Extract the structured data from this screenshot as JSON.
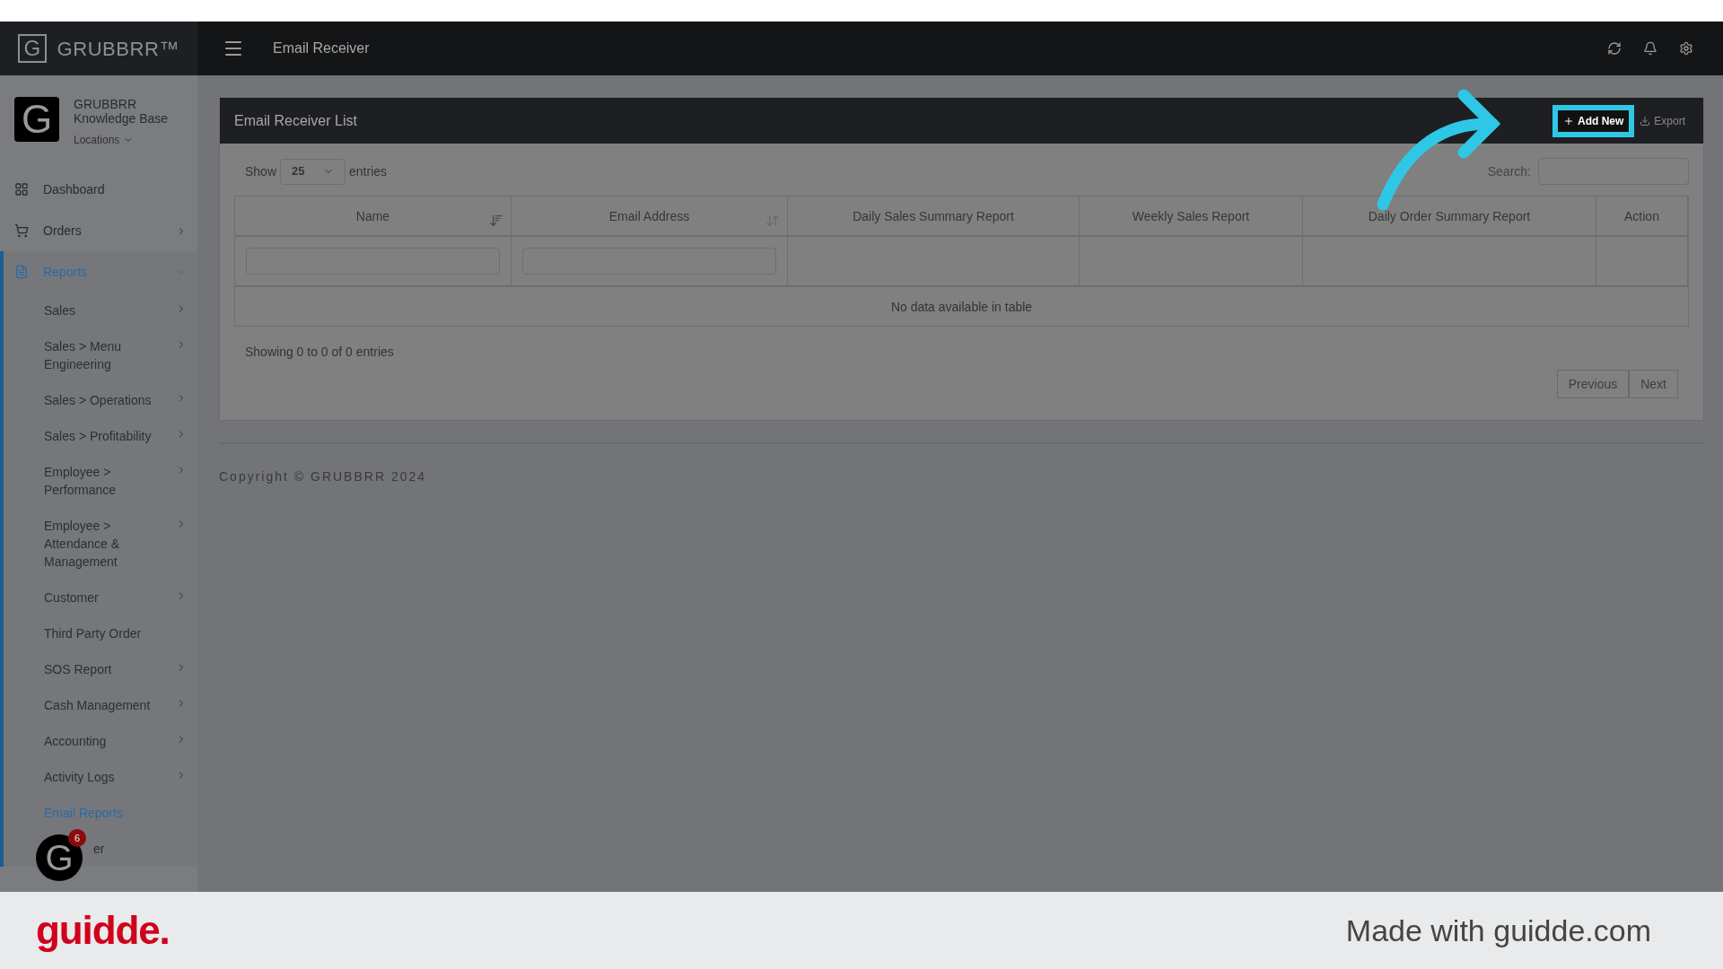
{
  "brand": {
    "logo_letter": "G",
    "name": "GRUBBRR™"
  },
  "header": {
    "title": "Email Receiver"
  },
  "profile": {
    "avatar_letter": "G",
    "name": "GRUBBRR Knowledge Base",
    "locations": "Locations"
  },
  "nav": [
    {
      "label": "Dashboard",
      "kind": "link",
      "selected": false
    },
    {
      "label": "Orders",
      "kind": "menu",
      "selected": false
    },
    {
      "label": "Reports",
      "kind": "open_menu",
      "selected": true,
      "children": [
        {
          "label": "Sales",
          "kind": "menu",
          "selected": false
        },
        {
          "label": "Sales > Menu Engineering",
          "kind": "menu",
          "selected": false
        },
        {
          "label": "Sales > Operations",
          "kind": "menu",
          "selected": false
        },
        {
          "label": "Sales > Profitability",
          "kind": "menu",
          "selected": false
        },
        {
          "label": "Employee > Performance",
          "kind": "menu",
          "selected": false
        },
        {
          "label": "Employee > Attendance & Management",
          "kind": "menu",
          "selected": false
        },
        {
          "label": "Customer",
          "kind": "menu",
          "selected": false
        },
        {
          "label": "Third Party Order",
          "kind": "link",
          "selected": false
        },
        {
          "label": "SOS Report",
          "kind": "menu",
          "selected": false
        },
        {
          "label": "Cash Management",
          "kind": "menu",
          "selected": false
        },
        {
          "label": "Accounting",
          "kind": "menu",
          "selected": false
        },
        {
          "label": "Activity Logs",
          "kind": "menu",
          "selected": false
        },
        {
          "label": "Email Reports",
          "kind": "link",
          "selected": true
        },
        {
          "label": "er",
          "kind": "covered",
          "selected": false
        }
      ]
    }
  ],
  "chat_badge": {
    "letter": "G",
    "count": "6"
  },
  "panel": {
    "title": "Email Receiver List",
    "add_button": "Add New",
    "export_button": "Export",
    "show_label": "Show",
    "page_size": "25",
    "entries_label": "entries",
    "search_label": "Search:",
    "columns": [
      "Name",
      "Email Address",
      "Daily Sales Summary Report",
      "Weekly Sales Report",
      "Daily Order Summary Report",
      "Action"
    ],
    "empty_message": "No data available in table",
    "info": "Showing 0 to 0 of 0 entries",
    "pagination": [
      {
        "label": "Previous",
        "disabled": true
      },
      {
        "label": "Next",
        "disabled": true
      }
    ]
  },
  "copyright": "Copyright © GRUBBRR 2024",
  "guidde_banner": {
    "logo": "guidde.",
    "text": "Made with guidde.com"
  }
}
